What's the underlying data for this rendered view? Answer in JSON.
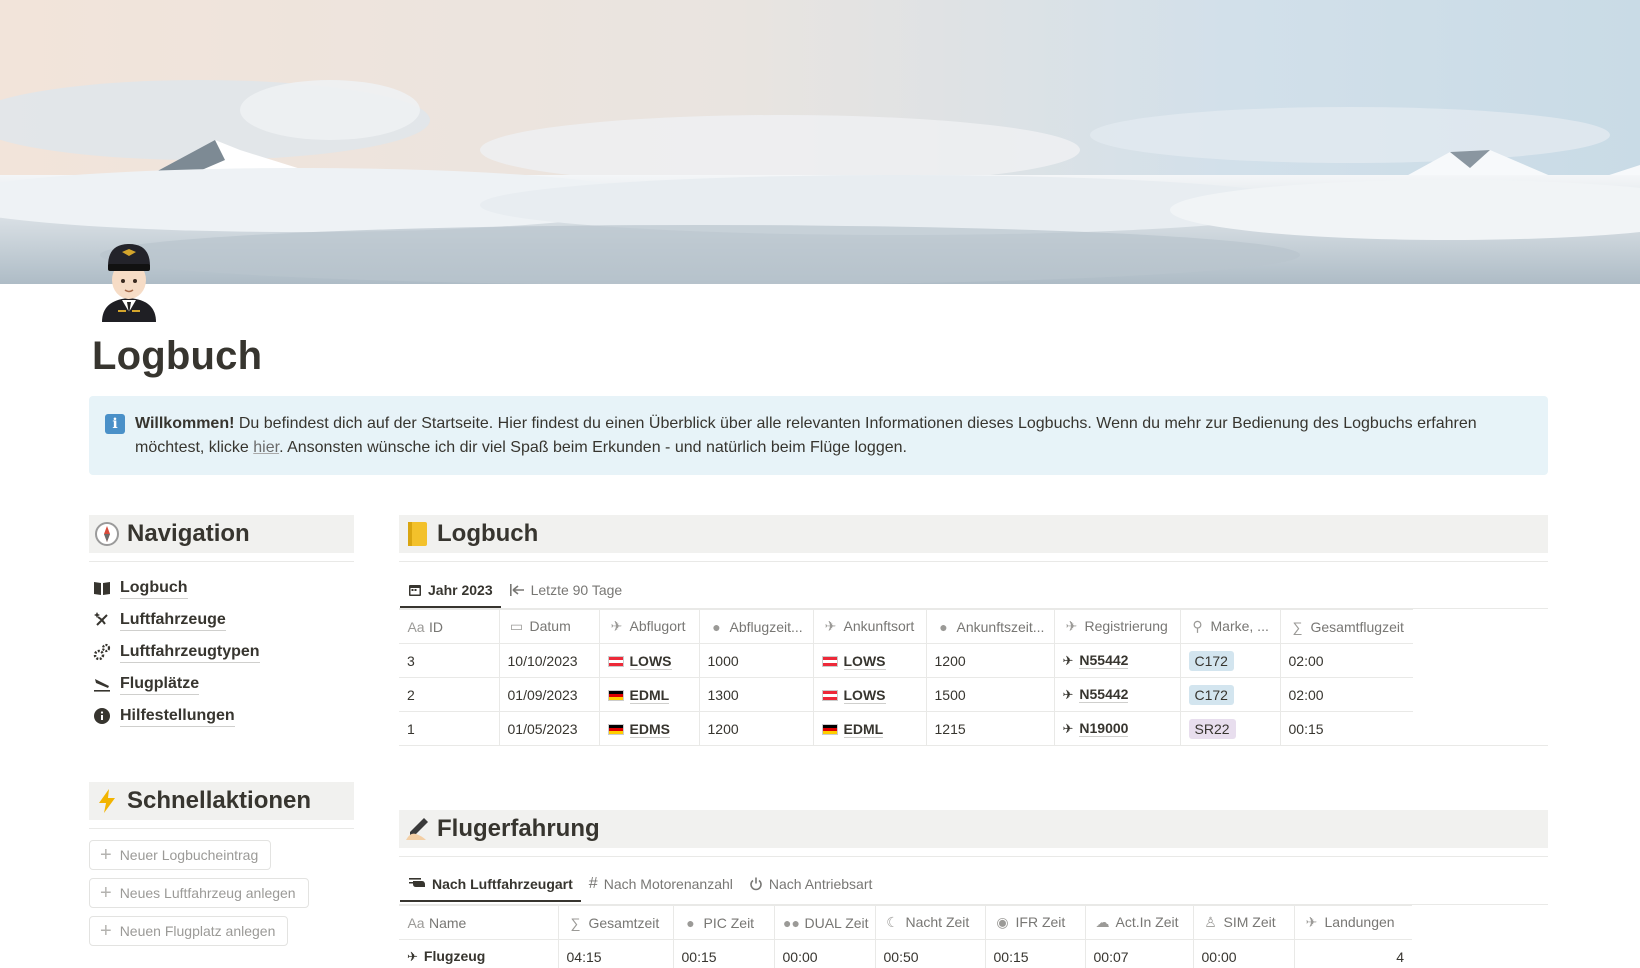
{
  "page": {
    "title": "Logbuch",
    "icon": "pilot-emoji-icon"
  },
  "callout": {
    "icon": "info-icon",
    "bold": "Willkommen!",
    "text1": " Du befindest dich auf der Startseite. Hier findest du einen Überblick über alle relevanten Informationen dieses Logbuchs. Wenn du mehr zur Bedienung des Logbuchs erfahren möchtest, klicke ",
    "link": "hier",
    "text2": ". Ansonsten wünsche ich dir viel Spaß beim Erkunden - und natürlich beim Flüge loggen."
  },
  "navigation": {
    "heading": "Navigation",
    "icon": "compass-icon",
    "items": [
      {
        "label": "Logbuch",
        "icon": "book-icon"
      },
      {
        "label": "Luftfahrzeuge",
        "icon": "sparkle-plane-icon"
      },
      {
        "label": "Luftfahrzeugtypen",
        "icon": "gears-icon"
      },
      {
        "label": "Flugplätze",
        "icon": "landing-icon"
      },
      {
        "label": "Hilfestellungen",
        "icon": "info-circle-icon"
      }
    ]
  },
  "quick_actions": {
    "heading": "Schnellaktionen",
    "icon": "lightning-icon",
    "buttons": [
      "Neuer Logbucheintrag",
      "Neues Luftfahrzeug anlegen",
      "Neuen Flugplatz anlegen"
    ]
  },
  "logbook": {
    "heading": "Logbuch",
    "icon": "notebook-icon",
    "tabs": [
      {
        "label": "Jahr 2023",
        "icon": "calendar-icon",
        "active": true
      },
      {
        "label": "Letzte 90 Tage",
        "icon": "arrow-left-bar-icon",
        "active": false
      }
    ],
    "columns": [
      "ID",
      "Datum",
      "Abflugort",
      "Abflugzeit...",
      "Ankunftsort",
      "Ankunftszeit...",
      "Registrierung",
      "Marke, ...",
      "Gesamtflugzeit"
    ],
    "rows": [
      {
        "id": "3",
        "datum": "10/10/2023",
        "abflugort": "LOWS",
        "abflug_flag": "at",
        "abflugzeit": "1000",
        "ankunftsort": "LOWS",
        "ankunft_flag": "at",
        "ankunftszeit": "1200",
        "registrierung": "N55442",
        "marke": "C172",
        "marke_color": "#d3e5ef",
        "gesamtflugzeit": "02:00"
      },
      {
        "id": "2",
        "datum": "01/09/2023",
        "abflugort": "EDML",
        "abflug_flag": "de",
        "abflugzeit": "1300",
        "ankunftsort": "LOWS",
        "ankunft_flag": "at",
        "ankunftszeit": "1500",
        "registrierung": "N55442",
        "marke": "C172",
        "marke_color": "#d3e5ef",
        "gesamtflugzeit": "02:00"
      },
      {
        "id": "1",
        "datum": "01/05/2023",
        "abflugort": "EDMS",
        "abflug_flag": "de",
        "abflugzeit": "1200",
        "ankunftsort": "EDML",
        "ankunft_flag": "de",
        "ankunftszeit": "1215",
        "registrierung": "N19000",
        "marke": "SR22",
        "marke_color": "#e8deee",
        "gesamtflugzeit": "00:15"
      }
    ]
  },
  "experience": {
    "heading": "Flugerfahrung",
    "icon": "writing-hand-icon",
    "tabs": [
      {
        "label": "Nach Luftfahrzeugart",
        "icon": "helicopter-icon",
        "active": true
      },
      {
        "label": "Nach Motorenanzahl",
        "icon": "hash-icon",
        "active": false
      },
      {
        "label": "Nach Antriebsart",
        "icon": "power-icon",
        "active": false
      }
    ],
    "columns": [
      "Name",
      "Gesamtzeit",
      "PIC Zeit",
      "DUAL Zeit",
      "Nacht Zeit",
      "IFR Zeit",
      "Act.In Zeit",
      "SIM Zeit",
      "Landungen"
    ],
    "rows": [
      {
        "name": "Flugzeug",
        "gesamtzeit": "04:15",
        "pic": "00:15",
        "dual": "00:00",
        "nacht": "00:50",
        "ifr": "00:15",
        "actin": "00:07",
        "sim": "00:00",
        "landungen": "4"
      }
    ]
  }
}
